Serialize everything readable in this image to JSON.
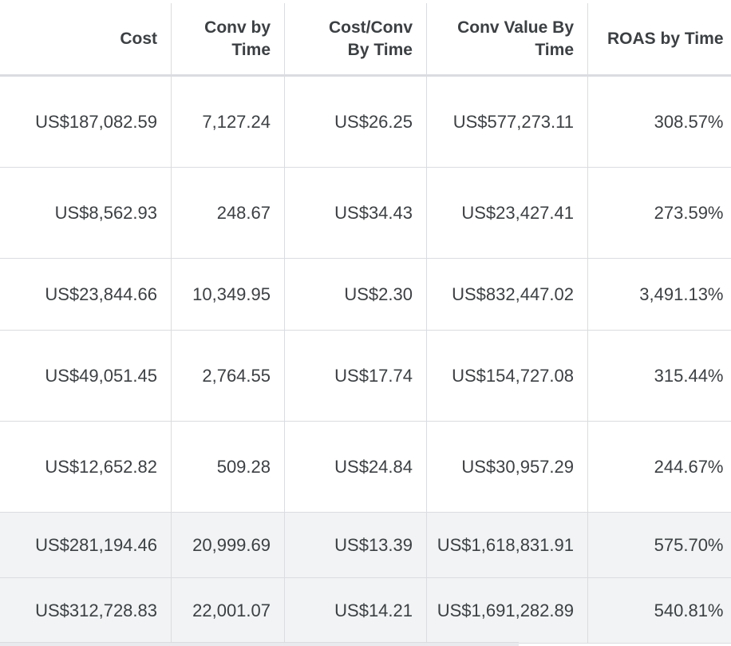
{
  "columns": [
    "Cost",
    "Conv by Time",
    "Cost/Conv By Time",
    "Conv Value By Time",
    "ROAS by Time"
  ],
  "column_lines": [
    [
      "Cost"
    ],
    [
      "Conv by",
      "Time"
    ],
    [
      "Cost/Conv",
      "By Time"
    ],
    [
      "Conv Value By",
      "Time"
    ],
    [
      "ROAS by Time"
    ]
  ],
  "rows": [
    {
      "cost": "US$187,082.59",
      "conv": "7,127.24",
      "cost_conv": "US$26.25",
      "conv_value": "US$577,273.11",
      "roas": "308.57%"
    },
    {
      "cost": "US$8,562.93",
      "conv": "248.67",
      "cost_conv": "US$34.43",
      "conv_value": "US$23,427.41",
      "roas": "273.59%"
    },
    {
      "cost": "US$23,844.66",
      "conv": "10,349.95",
      "cost_conv": "US$2.30",
      "conv_value": "US$832,447.02",
      "roas": "3,491.13%"
    },
    {
      "cost": "US$49,051.45",
      "conv": "2,764.55",
      "cost_conv": "US$17.74",
      "conv_value": "US$154,727.08",
      "roas": "315.44%"
    },
    {
      "cost": "US$12,652.82",
      "conv": "509.28",
      "cost_conv": "US$24.84",
      "conv_value": "US$30,957.29",
      "roas": "244.67%"
    }
  ],
  "totals": [
    {
      "cost": "US$281,194.46",
      "conv": "20,999.69",
      "cost_conv": "US$13.39",
      "conv_value": "US$1,618,831.91",
      "roas": "575.70%"
    },
    {
      "cost": "US$312,728.83",
      "conv": "22,001.07",
      "cost_conv": "US$14.21",
      "conv_value": "US$1,691,282.89",
      "roas": "540.81%"
    }
  ]
}
